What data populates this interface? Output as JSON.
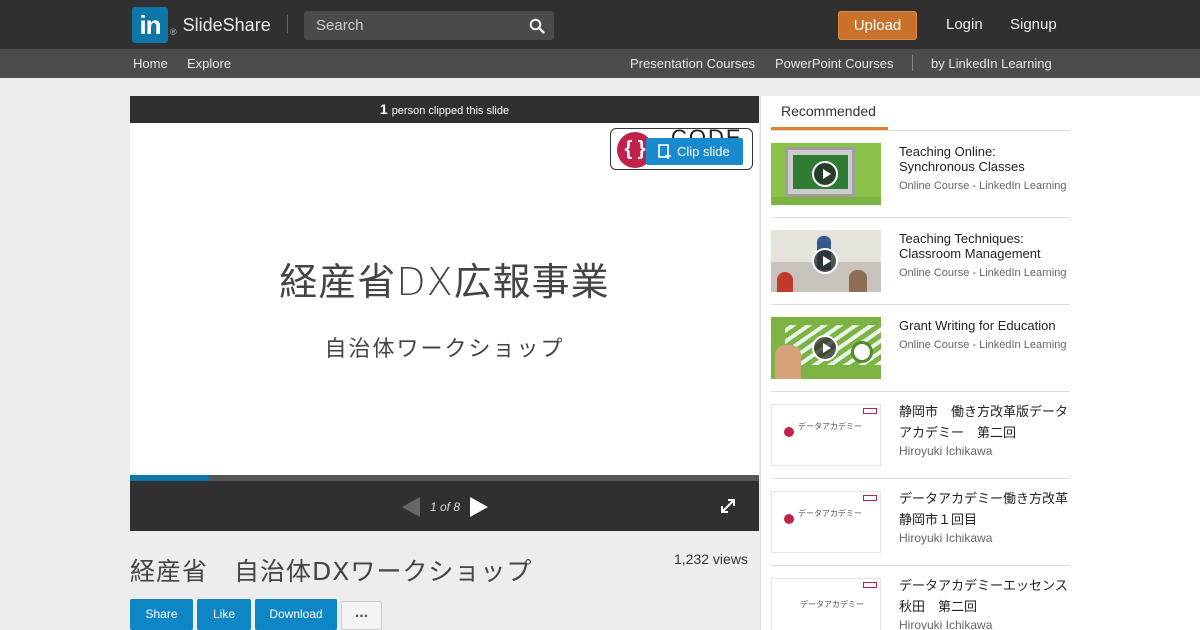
{
  "header": {
    "logo_mark": "in",
    "logo_reg": "®",
    "brand": "SlideShare",
    "search_placeholder": "Search",
    "upload": "Upload",
    "login": "Login",
    "signup": "Signup"
  },
  "subnav": {
    "home": "Home",
    "explore": "Explore",
    "presentation_courses": "Presentation Courses",
    "powerpoint_courses": "PowerPoint Courses",
    "linkedin_learning": "by LinkedIn Learning"
  },
  "player": {
    "clip_count": "1",
    "clip_text": "person clipped this slide",
    "clip_button": "Clip slide",
    "slide_title": "経産省DX広報事業",
    "slide_subtitle": "自治体ワークショップ",
    "logo_word": "CODE",
    "page_indicator": "1 of 8",
    "progress": 0.125
  },
  "presentation": {
    "title": "経産省　自治体DXワークショップ",
    "views": "1,232 views",
    "actions": {
      "share": "Share",
      "like": "Like",
      "download": "Download",
      "more": "..."
    }
  },
  "sidebar": {
    "tab": "Recommended",
    "items": [
      {
        "title": "Teaching Online: Synchronous Classes",
        "meta": "Online Course - LinkedIn Learning"
      },
      {
        "title": "Teaching Techniques: Classroom Management",
        "meta": "Online Course - LinkedIn Learning"
      },
      {
        "title": "Grant Writing for Education",
        "meta": "Online Course - LinkedIn Learning"
      },
      {
        "title": "静岡市　働き方改革版データアカデミー　第二回",
        "meta": "Hiroyuki Ichikawa",
        "thumb_title": "データアカデミー"
      },
      {
        "title": "データアカデミー働き方改革　静岡市１回目",
        "meta": "Hiroyuki Ichikawa",
        "thumb_title": "データアカデミー"
      },
      {
        "title": "データアカデミーエッセンス秋田　第二回",
        "meta": "Hiroyuki Ichikawa",
        "thumb_title": "データアカデミー"
      }
    ]
  },
  "colors": {
    "topbar": "#303030",
    "subnav": "#4c4c4c",
    "upload": "#c9702a",
    "accent_blue": "#0e86c6",
    "tab_underline": "#e0822a"
  }
}
